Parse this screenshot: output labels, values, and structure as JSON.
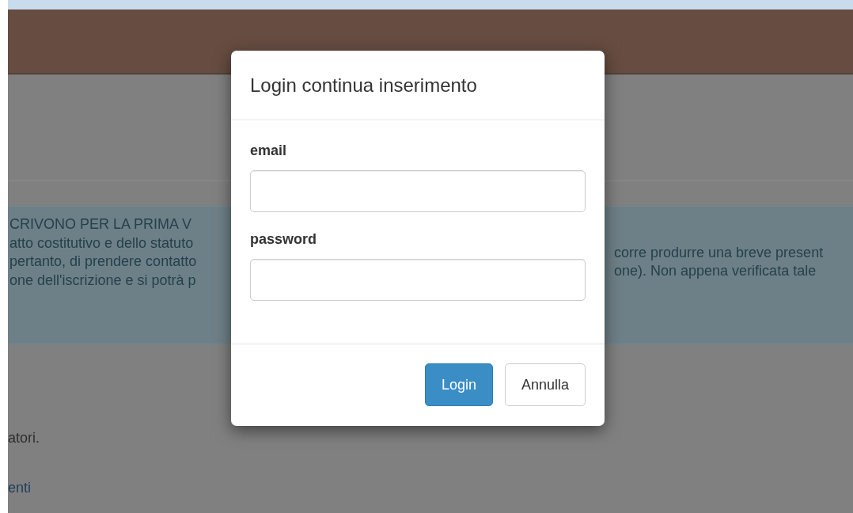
{
  "notice": {
    "left_lines": [
      "CRIVONO PER LA PRIMA V",
      "atto costitutivo e dello statuto",
      "pertanto, di prendere contatto",
      "one dell'iscrizione e si potrà p"
    ],
    "right_lines": [
      "corre produrre una breve present",
      "one). Non appena verificata tale"
    ]
  },
  "below": [
    {
      "text": "atori.",
      "kind": "text"
    },
    {
      "text": "enti",
      "kind": "link"
    }
  ],
  "modal": {
    "title": "Login continua inserimento",
    "fields": [
      {
        "label": "email"
      },
      {
        "label": "password"
      }
    ],
    "buttons": [
      {
        "label": "Login",
        "kind": "primary"
      },
      {
        "label": "Annulla",
        "kind": "default"
      }
    ]
  }
}
